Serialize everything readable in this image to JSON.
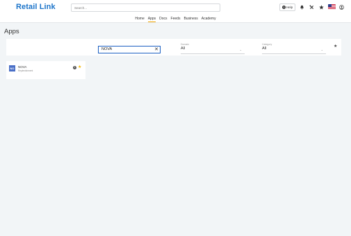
{
  "header": {
    "logo": "Retail Link",
    "search_placeholder": "Search...",
    "help_label": "Help",
    "icons": [
      "bell-icon",
      "tools-icon",
      "star-icon",
      "us-flag-icon",
      "user-icon"
    ]
  },
  "nav": {
    "items": [
      "Home",
      "Apps",
      "Docs",
      "Feeds",
      "Business",
      "Academy"
    ],
    "active": "Apps"
  },
  "page": {
    "title": "Apps"
  },
  "filters": {
    "search_value": "NOVA",
    "domain": {
      "label": "Domain",
      "value": "All"
    },
    "category": {
      "label": "Category",
      "value": "All"
    }
  },
  "apps": [
    {
      "icon_text": "NO",
      "name": "NOVA",
      "category": "Replenishment",
      "favorited": true
    }
  ],
  "colors": {
    "brand": "#1a73c9",
    "accent": "#f0a500",
    "focus": "#1b5fc1",
    "favorite": "#f2b600",
    "app_icon": "#4a6fc7"
  }
}
